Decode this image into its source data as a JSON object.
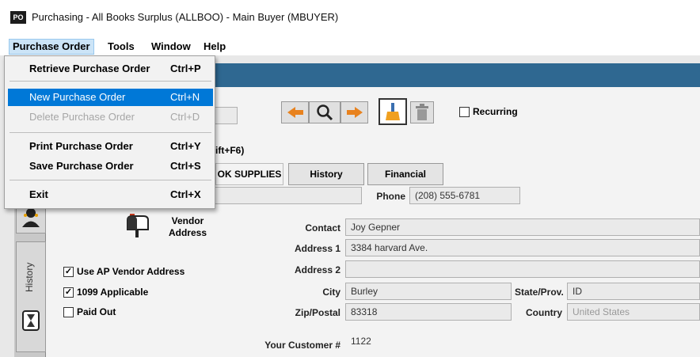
{
  "window": {
    "icon_text": "PO",
    "title": "Purchasing - All Books Surplus (ALLBOO) - Main Buyer (MBUYER)"
  },
  "menubar": {
    "items": [
      "Purchase Order",
      "Tools",
      "Window",
      "Help"
    ]
  },
  "dropdown": {
    "items": [
      {
        "label": "Retrieve Purchase Order",
        "shortcut": "Ctrl+P"
      },
      {
        "label": "New Purchase Order",
        "shortcut": "Ctrl+N"
      },
      {
        "label": "Delete Purchase Order",
        "shortcut": "Ctrl+D"
      },
      {
        "label": "Print Purchase Order",
        "shortcut": "Ctrl+Y"
      },
      {
        "label": "Save Purchase Order",
        "shortcut": "Ctrl+S"
      },
      {
        "label": "Exit",
        "shortcut": "Ctrl+X"
      }
    ]
  },
  "toolbar": {
    "recurring_label": "Recurring"
  },
  "partial": {
    "hint": "ift+F6)",
    "vendor_name_fragment": "OK SUPPLIES"
  },
  "tabs": {
    "history": "History",
    "financial": "Financial"
  },
  "phone": {
    "label": "Phone",
    "value": "(208) 555-6781"
  },
  "vendor": {
    "address_label_line1": "Vendor",
    "address_label_line2": "Address"
  },
  "form": {
    "contact": {
      "label": "Contact",
      "value": "Joy Gepner"
    },
    "address1": {
      "label": "Address 1",
      "value": "3384 harvard Ave."
    },
    "address2": {
      "label": "Address 2",
      "value": ""
    },
    "city": {
      "label": "City",
      "value": "Burley"
    },
    "state": {
      "label": "State/Prov.",
      "value": "ID"
    },
    "zip": {
      "label": "Zip/Postal",
      "value": "83318"
    },
    "country": {
      "label": "Country",
      "value": "United States"
    },
    "customer_no": {
      "label": "Your Customer #",
      "value": "1122"
    }
  },
  "checks": {
    "use_ap": {
      "label": "Use AP Vendor Address",
      "checked": true
    },
    "ten99": {
      "label": "1099 Applicable",
      "checked": true
    },
    "paid_out": {
      "label": "Paid Out",
      "checked": false
    }
  },
  "rail": {
    "history_label": "History"
  },
  "colors": {
    "accent": "#0078d7",
    "header": "#2f6891",
    "arrow": "#e8821e"
  }
}
